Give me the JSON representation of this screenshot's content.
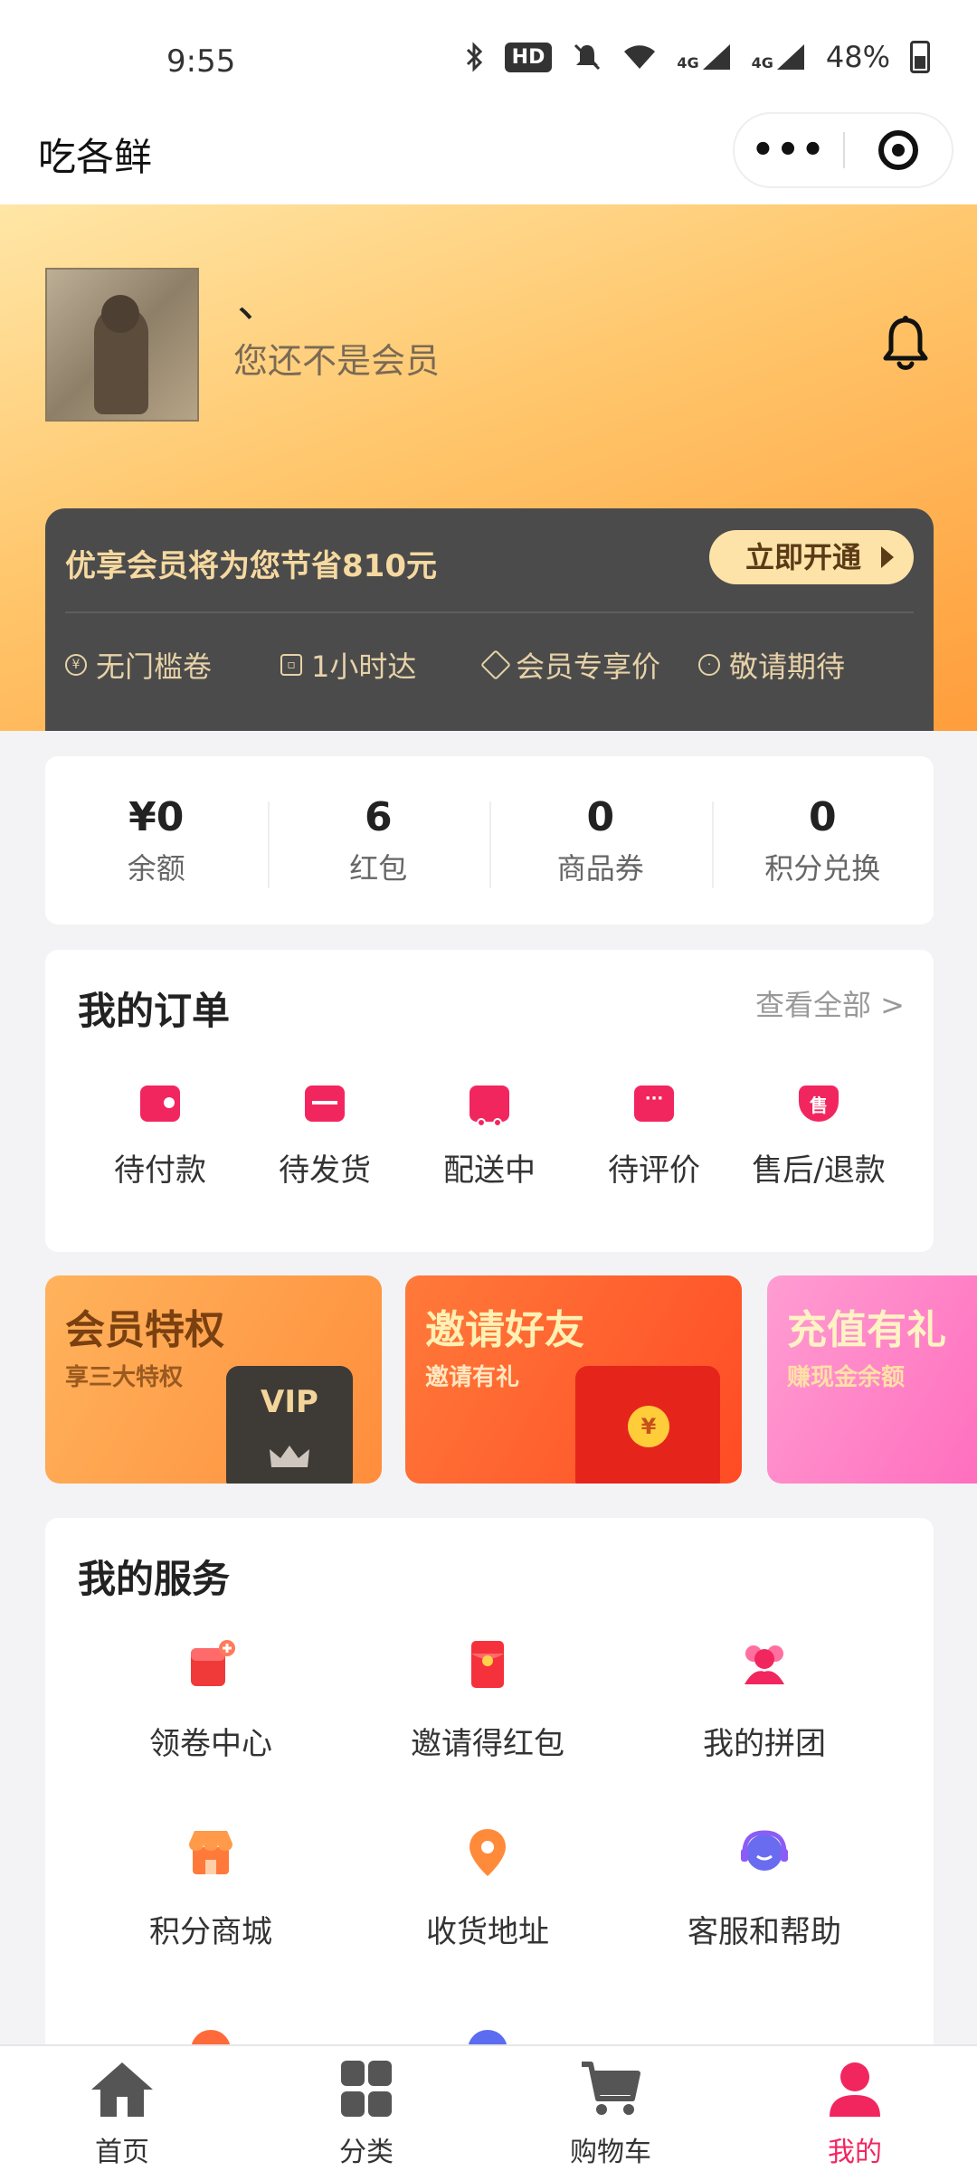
{
  "status_bar": {
    "time": "9:55",
    "hd": "HD",
    "network_a": "4G",
    "network_b": "4G",
    "battery": "48%"
  },
  "header": {
    "app_title": "吃各鲜",
    "nickname": "、",
    "member_status": "您还不是会员"
  },
  "member_card": {
    "promo_text": "优享会员将为您节省810元",
    "button_label": "立即开通",
    "perks": [
      {
        "label": "无门槛卷",
        "icon": "coupon-icon"
      },
      {
        "label": "1小时达",
        "icon": "delivery-icon"
      },
      {
        "label": "会员专享价",
        "icon": "diamond-icon"
      },
      {
        "label": "敬请期待",
        "icon": "more-icon"
      }
    ]
  },
  "stats": [
    {
      "value": "¥0",
      "label": "余额"
    },
    {
      "value": "6",
      "label": "红包"
    },
    {
      "value": "0",
      "label": "商品券"
    },
    {
      "value": "0",
      "label": "积分兑换"
    }
  ],
  "orders": {
    "title": "我的订单",
    "view_all": "查看全部 >",
    "items": [
      {
        "label": "待付款",
        "icon": "wallet-icon"
      },
      {
        "label": "待发货",
        "icon": "package-icon"
      },
      {
        "label": "配送中",
        "icon": "truck-icon"
      },
      {
        "label": "待评价",
        "icon": "comment-icon"
      },
      {
        "label": "售后/退款",
        "icon": "shield-icon",
        "glyph": "售"
      }
    ]
  },
  "banners": [
    {
      "title": "会员特权",
      "subtitle": "享三大特权",
      "badge": "VIP"
    },
    {
      "title": "邀请好友",
      "subtitle": "邀请有礼",
      "badge": "¥"
    },
    {
      "title": "充值有礼",
      "subtitle": "赚现金余额"
    }
  ],
  "services": {
    "title": "我的服务",
    "items": [
      {
        "label": "领卷中心",
        "icon": "coupon-center-icon"
      },
      {
        "label": "邀请得红包",
        "icon": "red-envelope-icon"
      },
      {
        "label": "我的拼团",
        "icon": "group-icon"
      },
      {
        "label": "积分商城",
        "icon": "shop-icon"
      },
      {
        "label": "收货地址",
        "icon": "location-icon"
      },
      {
        "label": "客服和帮助",
        "icon": "customer-service-icon"
      }
    ]
  },
  "tabbar": [
    {
      "label": "首页",
      "icon": "home-icon"
    },
    {
      "label": "分类",
      "icon": "category-icon"
    },
    {
      "label": "购物车",
      "icon": "cart-icon"
    },
    {
      "label": "我的",
      "icon": "user-icon",
      "active": true
    }
  ],
  "colors": {
    "accent": "#f2265f",
    "member_card": "#4b4b4b",
    "gold_text": "#f6d9a0"
  }
}
